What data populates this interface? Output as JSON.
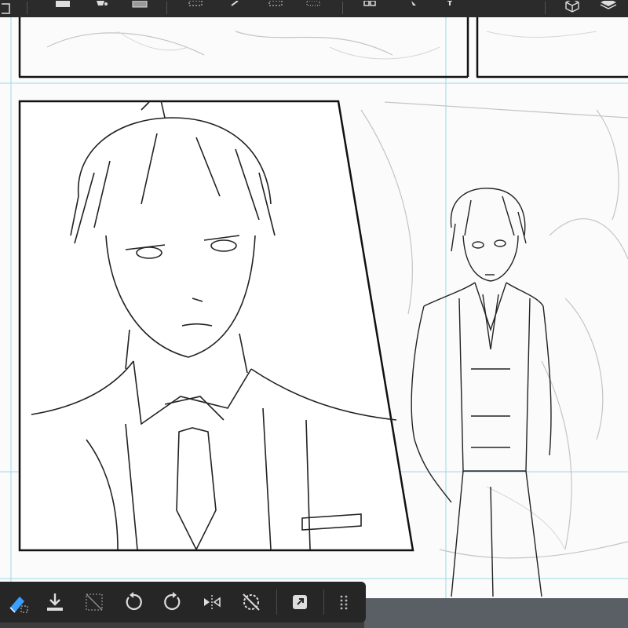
{
  "app": {
    "accent": "#3aa0ff",
    "toolbar_bg": "#262626"
  },
  "top_toolbar": {
    "icons": [
      "layer-icon",
      "color-swatch-icon",
      "fill-bucket-icon",
      "gradient-icon",
      "selection-rect-icon",
      "eyedropper-icon",
      "selection-lasso-icon",
      "selection-dotted-icon",
      "transform-icon",
      "pointer-icon",
      "text-icon",
      "3d-cube-icon",
      "layers-stack-icon"
    ]
  },
  "bottom_toolbar": {
    "buttons": [
      {
        "name": "clear-selection-button",
        "icon": "eraser-icon"
      },
      {
        "name": "save-button",
        "icon": "download-icon"
      },
      {
        "name": "crop-button",
        "icon": "crop-icon"
      },
      {
        "name": "undo-button",
        "icon": "undo-icon"
      },
      {
        "name": "redo-button",
        "icon": "redo-icon"
      },
      {
        "name": "flip-horizontal-button",
        "icon": "flip-horizontal-icon"
      },
      {
        "name": "deselect-button",
        "icon": "deselect-icon"
      },
      {
        "name": "share-button",
        "icon": "share-icon"
      },
      {
        "name": "more-button",
        "icon": "grid-dots-icon"
      }
    ]
  }
}
